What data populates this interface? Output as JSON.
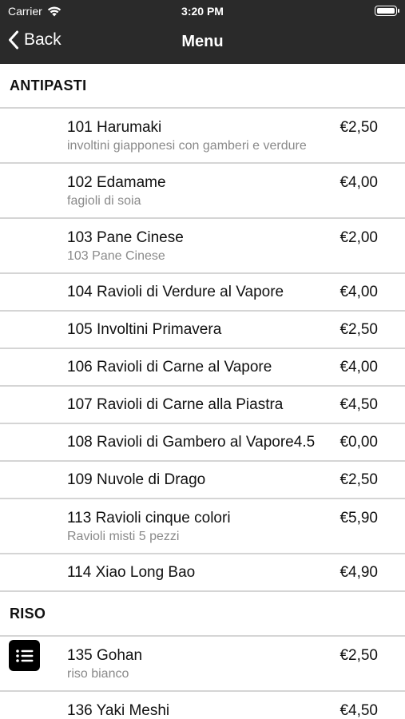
{
  "status_bar": {
    "carrier": "Carrier",
    "time": "3:20 PM"
  },
  "nav": {
    "back_label": "Back",
    "title": "Menu"
  },
  "sections": [
    {
      "title": "ANTIPASTI",
      "items": [
        {
          "name": "101 Harumaki",
          "desc": "involtini giapponesi con gamberi e verdure",
          "price": "€2,50"
        },
        {
          "name": "102 Edamame",
          "desc": "fagioli di soia",
          "price": "€4,00"
        },
        {
          "name": "103 Pane Cinese",
          "desc": "103 Pane Cinese",
          "price": "€2,00"
        },
        {
          "name": "104 Ravioli di Verdure al Vapore",
          "price": "€4,00"
        },
        {
          "name": "105 Involtini Primavera",
          "price": "€2,50"
        },
        {
          "name": "106 Ravioli di Carne al Vapore",
          "price": "€4,00"
        },
        {
          "name": "107 Ravioli di Carne alla Piastra",
          "price": "€4,50"
        },
        {
          "name": "108 Ravioli di Gambero al Vapore4.5",
          "price": "€0,00"
        },
        {
          "name": "109 Nuvole di Drago",
          "price": "€2,50"
        },
        {
          "name": "113 Ravioli cinque colori",
          "desc": "Ravioli misti 5 pezzi",
          "price": "€5,90"
        },
        {
          "name": "114 Xiao Long Bao",
          "price": "€4,90"
        }
      ]
    },
    {
      "title": "RISO",
      "items": [
        {
          "name": "135 Gohan",
          "desc": "riso bianco",
          "price": "€2,50",
          "icon": "list-icon"
        },
        {
          "name": "136 Yaki Meshi",
          "desc": "",
          "price": "€4,50"
        }
      ]
    }
  ]
}
